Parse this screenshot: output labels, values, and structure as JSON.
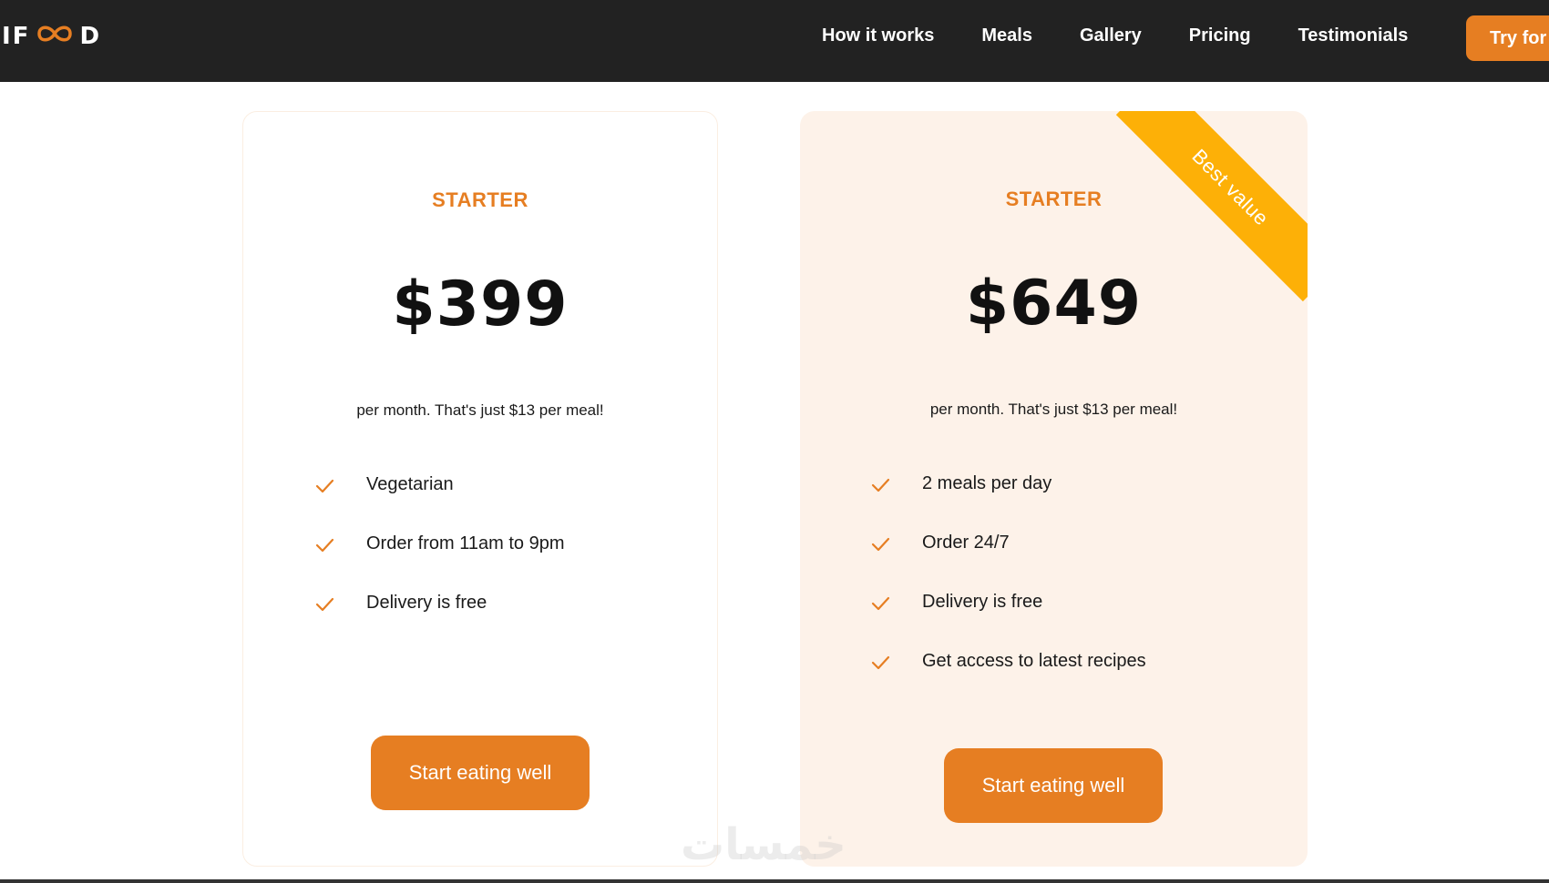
{
  "header": {
    "logo": {
      "prefix": "IF",
      "suffix": "D",
      "icon": "infinity-icon"
    },
    "nav": [
      {
        "label": "How it works"
      },
      {
        "label": "Meals"
      },
      {
        "label": "Gallery"
      },
      {
        "label": "Pricing"
      },
      {
        "label": "Testimonials"
      }
    ],
    "cta_label": "Try for"
  },
  "plans": [
    {
      "name": "STARTER",
      "price": "$399",
      "description": "per month. That's just $13 per meal!",
      "features": [
        {
          "text": "Vegetarian"
        },
        {
          "text": "Order from 11am to 9pm"
        },
        {
          "text": "Delivery is free"
        }
      ],
      "cta_label": "Start eating well"
    },
    {
      "name": "STARTER",
      "price": "$649",
      "description": "per month. That's just $13 per meal!",
      "ribbon": "Best value",
      "features": [
        {
          "text": "2 meals per day"
        },
        {
          "text": "Order 24/7"
        },
        {
          "text": "Delivery is free"
        },
        {
          "text": "Get access to latest recipes"
        }
      ],
      "cta_label": "Start eating well"
    }
  ],
  "watermark": "خمسات",
  "colors": {
    "accent": "#e67e22",
    "header_bg": "#222222",
    "highlight_card_bg": "#fdf2e9",
    "ribbon": "#fdb007"
  },
  "icons": {
    "feature": "check-icon"
  }
}
